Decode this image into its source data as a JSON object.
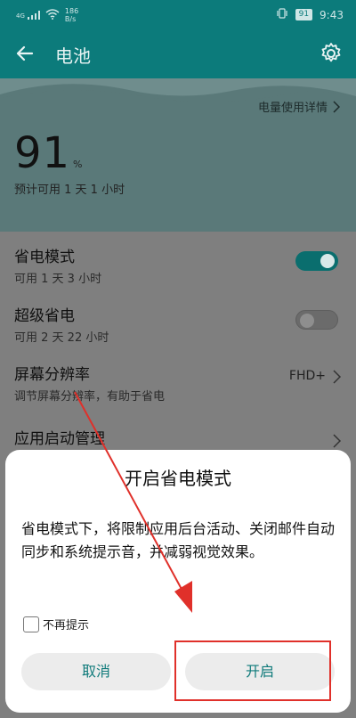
{
  "status_bar": {
    "signal_label": "4G",
    "speed_value": "186",
    "speed_unit": "B/s",
    "battery_level": "91",
    "time": "9:43",
    "icons": [
      "signal-icon",
      "wifi-icon",
      "vibrate-icon",
      "battery-icon"
    ]
  },
  "app_bar": {
    "title": "电池",
    "back_icon": "back-arrow-icon",
    "settings_icon": "gear-icon"
  },
  "battery": {
    "details_link": "电量使用详情",
    "percent": "91",
    "percent_symbol": "%",
    "estimate": "预计可用 1 天 1 小时"
  },
  "settings": [
    {
      "title": "省电模式",
      "subtitle": "可用 1 天 3 小时",
      "control": "toggle",
      "toggle_on": true
    },
    {
      "title": "超级省电",
      "subtitle": "可用 2 天 22 小时",
      "control": "toggle",
      "toggle_on": false
    },
    {
      "title": "屏幕分辨率",
      "subtitle": "调节屏幕分辨率，有助于省电",
      "control": "value",
      "value": "FHD+"
    },
    {
      "title": "应用启动管理",
      "subtitle": "",
      "control": "chevron"
    }
  ],
  "dialog": {
    "title": "开启省电模式",
    "message": "省电模式下，将限制应用后台活动、关闭邮件自动同步和系统提示音，并减弱视觉效果。",
    "checkbox_label": "不再提示",
    "checkbox_checked": false,
    "cancel_label": "取消",
    "confirm_label": "开启"
  },
  "colors": {
    "accent": "#0c7b7b",
    "annotation_red": "#e0302a"
  }
}
